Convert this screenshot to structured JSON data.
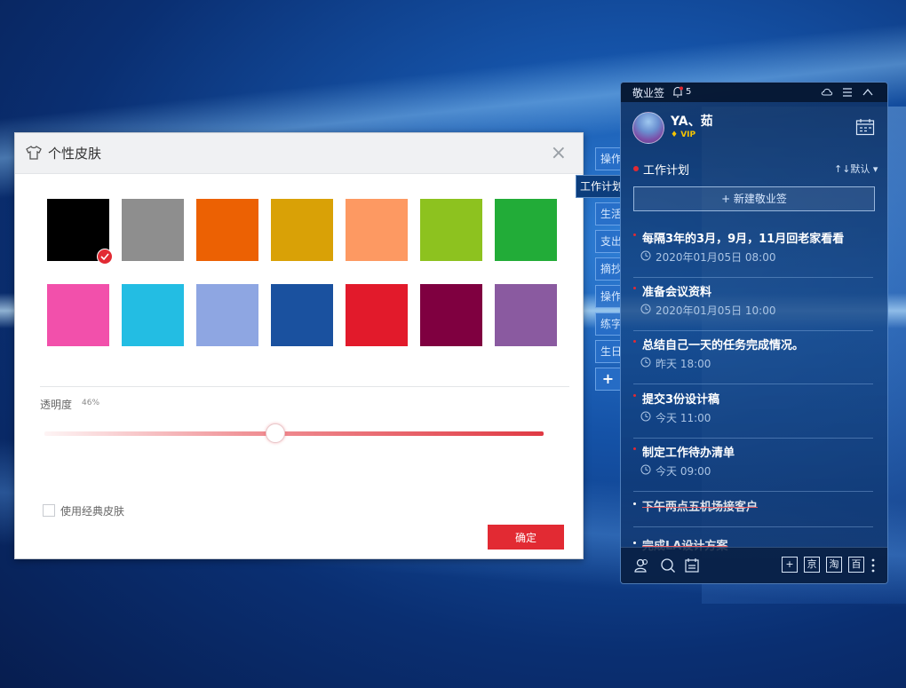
{
  "skin_dialog": {
    "title": "个性皮肤",
    "close_label": "×",
    "swatches_row1": [
      "#000000",
      "#8e8e8e",
      "#ec6103",
      "#d9a106",
      "#fd9962",
      "#8dc21f",
      "#22ac38"
    ],
    "swatches_row2": [
      "#f250ab",
      "#23bde3",
      "#8ea6e2",
      "#1a519f",
      "#e21a2b",
      "#7f0040",
      "#8a5aa0"
    ],
    "selected_swatch": "#000000",
    "opacity_label": "透明度",
    "opacity_value": "46%",
    "opacity_fraction": 0.46,
    "accent_color": "#e22a33",
    "classic_skin_label": "使用经典皮肤",
    "classic_skin_checked": false,
    "confirm_label": "确定"
  },
  "side_tabs": [
    {
      "label": "操作"
    },
    {
      "label": "工作计划"
    },
    {
      "label": "生活"
    },
    {
      "label": "支出"
    },
    {
      "label": "摘抄"
    },
    {
      "label": "操作"
    },
    {
      "label": "练字"
    },
    {
      "label": "生日"
    },
    {
      "label": "+"
    }
  ],
  "note_panel": {
    "app_name": "敬业签",
    "bell_count": "5",
    "username": "YA、茹",
    "vip_label": "VIP",
    "list_title": "工作计划",
    "sort_label": "↑↓默认",
    "new_note_label": "+ 新建敬业签",
    "notes": [
      {
        "text": "每隔3年的3月，9月，11月回老家看看",
        "time": "2020年01月05日 08:00"
      },
      {
        "text": "准备会议资料",
        "time": "2020年01月05日 10:00"
      },
      {
        "text": "总结自己一天的任务完成情况。",
        "time": "昨天 18:00"
      },
      {
        "text": "提交3份设计稿",
        "time": "今天 11:00"
      },
      {
        "text": "制定工作待办清单",
        "time": "今天 09:00"
      }
    ],
    "done_notes": [
      {
        "text": "下午两点五机场接客户"
      },
      {
        "text": "完成LA设计方案"
      }
    ],
    "bottom_buttons": [
      "+",
      "京",
      "淘",
      "百"
    ]
  }
}
